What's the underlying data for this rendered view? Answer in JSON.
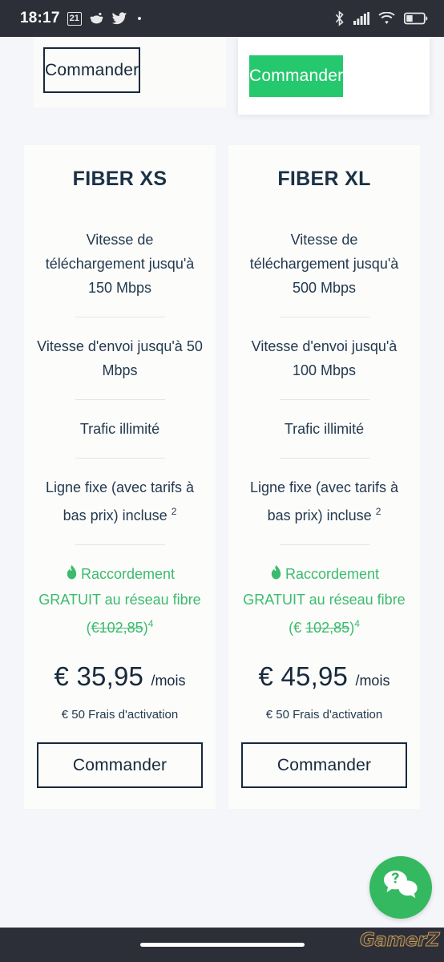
{
  "status_bar": {
    "time": "18:17",
    "calendar_badge": "21",
    "icons_left": [
      "calendar-icon",
      "reddit-icon",
      "twitter-icon",
      "dot-icon"
    ],
    "icons_right": [
      "bluetooth-icon",
      "cellular-signal-icon",
      "wifi-icon",
      "battery-icon"
    ],
    "background_color": "#2c2f38"
  },
  "top_partial": {
    "left_button_label": "Commander",
    "right_button_label": "Commander",
    "right_button_color": "#26c86e"
  },
  "theme": {
    "page_background": "#f4f6f9",
    "card_background": "#fcfcfb",
    "text_dark": "#17293b",
    "accent_green": "#3cbb6e",
    "button_green": "#26c86e",
    "divider": "#e3e5e7"
  },
  "plans": [
    {
      "title": "FIBER XS",
      "features": [
        "Vitesse de téléchargement jusqu'à 150 Mbps",
        "Vitesse d'envoi jusqu'à 50 Mbps",
        "Trafic illimité",
        "Ligne fixe (avec tarifs à bas prix) incluse"
      ],
      "feature_footnotes": [
        "",
        "",
        "",
        "2"
      ],
      "promo": {
        "icon": "flame-icon",
        "text_before": "Raccordement GRATUIT au réseau fibre (",
        "struck_price": "€102,85",
        "text_after": ")",
        "footnote": "4"
      },
      "price": "€ 35,95",
      "price_period": "/mois",
      "activation_fee": "€ 50 Frais d'activation",
      "cta_label": "Commander"
    },
    {
      "title": "FIBER XL",
      "features": [
        "Vitesse de téléchargement jusqu'à 500 Mbps",
        "Vitesse d'envoi jusqu'à 100 Mbps",
        "Trafic illimité",
        "Ligne fixe (avec tarifs à bas prix) incluse"
      ],
      "feature_footnotes": [
        "",
        "",
        "",
        "2"
      ],
      "promo": {
        "icon": "flame-icon",
        "text_before": "Raccordement GRATUIT au réseau fibre (€ ",
        "struck_price": "102,85",
        "text_after": ")",
        "footnote": "4"
      },
      "price": "€ 45,95",
      "price_period": "/mois",
      "activation_fee": "€ 50 Frais d'activation",
      "cta_label": "Commander"
    }
  ],
  "chat_widget": {
    "icon": "chat-question-icon",
    "color": "#34b961"
  },
  "watermark": {
    "text": "GamerZ"
  }
}
